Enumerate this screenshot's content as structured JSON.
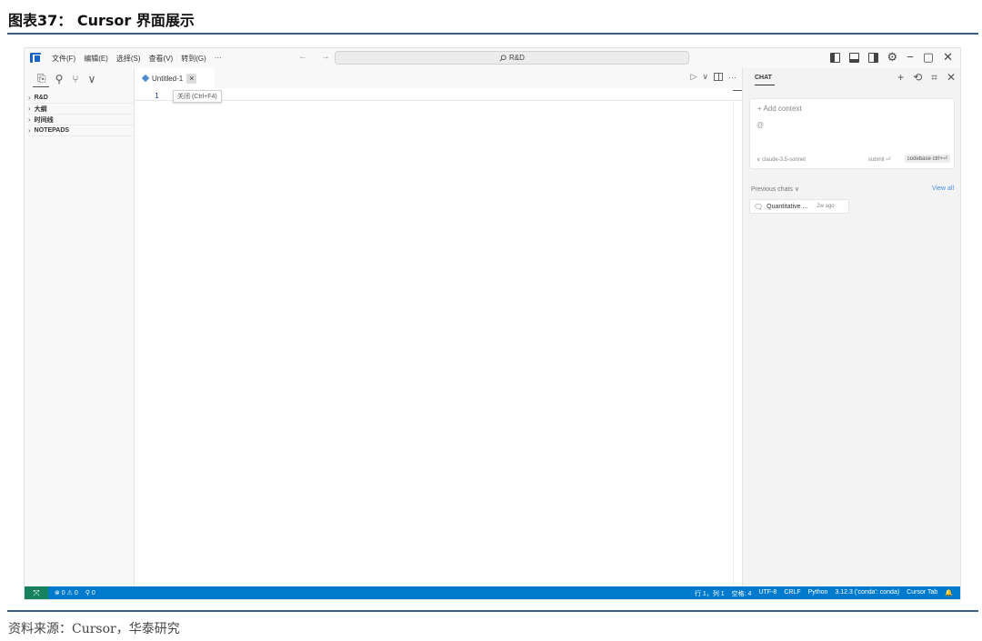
{
  "figure": {
    "title": "图表37：  Cursor 界面展示",
    "source": "资料来源：Cursor，华泰研究"
  },
  "titlebar": {
    "menu": [
      "文件(F)",
      "编辑(E)",
      "选择(S)",
      "查看(V)",
      "转到(G)",
      "···"
    ],
    "nav_arrows": "← →",
    "search_text": "R&D",
    "window_controls": {
      "minimize": "−",
      "restore": "▢",
      "close": "✕"
    }
  },
  "sidebar": {
    "sections": [
      "R&D",
      "大纲",
      "时间线",
      "NOTEPADS"
    ]
  },
  "editor": {
    "tab_label": "Untitled-1",
    "tab_close": "×",
    "line_number": "1",
    "tooltip": "关闭 (Ctrl+F4)",
    "actions": {
      "run": "▷",
      "run_more": "∨",
      "more": "···"
    }
  },
  "chat": {
    "title": "CHAT",
    "actions": {
      "new": "+",
      "history": "⟲",
      "more": "✕"
    },
    "add_context": "+ Add context",
    "at_symbol": "@",
    "model": "∨ claude-3.5-sonnet",
    "submit": "submit ⏎",
    "codebase": "codebase ctrl+⏎",
    "previous_chats": "Previous chats ∨",
    "view_all": "View all",
    "items": [
      {
        "title": "Quantitative ...",
        "age": "2w ago"
      }
    ]
  },
  "statusbar": {
    "remote": "⤧",
    "problems": "⊗ 0 ⚠ 0",
    "ports": "⚲ 0",
    "right": [
      "行 1，列 1",
      "空格: 4",
      "UTF-8",
      "CRLF",
      "Python",
      "3.12.3 ('conda': conda)",
      "Cursor Tab",
      "🔔"
    ]
  },
  "colors": {
    "accent": "#007acc",
    "remote": "#16825d",
    "logo": "#1a66c7",
    "rule": "#3c5f86",
    "link": "#4a90e2"
  }
}
